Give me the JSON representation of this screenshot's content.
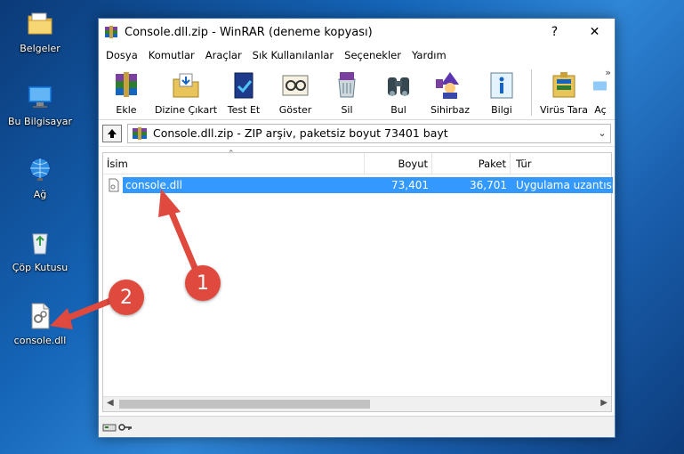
{
  "desktop": {
    "icons": [
      {
        "label": "Belgeler"
      },
      {
        "label": "Bu Bilgisayar"
      },
      {
        "label": "Ağ"
      },
      {
        "label": "Çöp Kutusu"
      },
      {
        "label": "console.dll"
      }
    ]
  },
  "window": {
    "title": "Console.dll.zip - WinRAR (deneme kopyası)",
    "help_label": "?",
    "close_label": "✕"
  },
  "menu": {
    "items": [
      "Dosya",
      "Komutlar",
      "Araçlar",
      "Sık Kullanılanlar",
      "Seçenekler",
      "Yardım"
    ]
  },
  "toolbar": {
    "items": [
      {
        "label": "Ekle",
        "icon": "add-archive-icon"
      },
      {
        "label": "Dizine Çıkart",
        "icon": "extract-to-icon"
      },
      {
        "label": "Test Et",
        "icon": "test-icon"
      },
      {
        "label": "Göster",
        "icon": "view-icon"
      },
      {
        "label": "Sil",
        "icon": "delete-icon"
      },
      {
        "label": "Bul",
        "icon": "find-icon"
      },
      {
        "label": "Sihirbaz",
        "icon": "wizard-icon"
      },
      {
        "label": "Bilgi",
        "icon": "info-icon"
      },
      {
        "label": "Virüs Tara",
        "icon": "virus-scan-icon"
      },
      {
        "label": "Aç",
        "icon": "open-icon"
      }
    ],
    "more_label": "»"
  },
  "address": {
    "value": "Console.dll.zip - ZIP arşiv, paketsiz boyut 73401 bayt"
  },
  "columns": [
    "İsim",
    "Boyut",
    "Paket",
    "Tür"
  ],
  "files": [
    {
      "name": "console.dll",
      "size": "73,401",
      "packed": "36,701",
      "type": "Uygulama uzantısı"
    }
  ],
  "annotations": [
    {
      "number": "1",
      "color": "#e04a3e"
    },
    {
      "number": "2",
      "color": "#e04a3e"
    }
  ],
  "colors": {
    "selection": "#3399ff",
    "annotation": "#e04a3e"
  }
}
